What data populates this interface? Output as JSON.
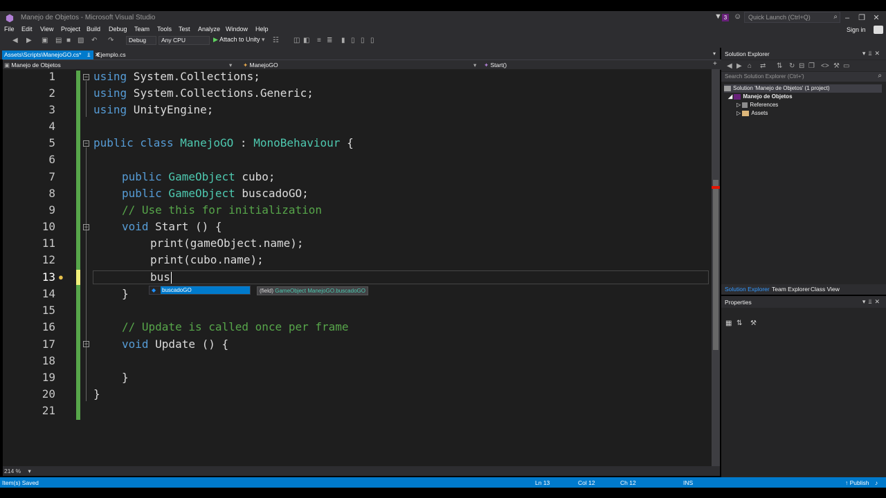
{
  "window": {
    "title": "Manejo de Objetos - Microsoft Visual Studio",
    "notification_count": "3",
    "quick_launch_placeholder": "Quick Launch (Ctrl+Q)",
    "sign_in": "Sign in"
  },
  "menu": [
    "File",
    "Edit",
    "View",
    "Project",
    "Build",
    "Debug",
    "Team",
    "Tools",
    "Test",
    "Analyze",
    "Window",
    "Help"
  ],
  "toolbar": {
    "configuration": "Debug",
    "platform": "Any CPU",
    "attach": "Attach to Unity"
  },
  "tabs": {
    "active": "Assets\\Scripts\\ManejoGO.cs*",
    "second": "Ejemplo.cs"
  },
  "navbar": {
    "project": "Manejo de Objetos",
    "class": "ManejoGO",
    "member": "Start()"
  },
  "editor": {
    "line_numbers": [
      "1",
      "2",
      "3",
      "4",
      "5",
      "6",
      "7",
      "8",
      "9",
      "10",
      "11",
      "12",
      "13",
      "14",
      "15",
      "16",
      "17",
      "18",
      "19",
      "20",
      "21"
    ],
    "lines": {
      "l1_kw": "using",
      "l1_rest": " System.Collections;",
      "l2_kw": "using",
      "l2_rest": " System.Collections.Generic;",
      "l3_kw": "using",
      "l3_rest": " UnityEngine;",
      "l5_kw": "public class",
      "l5_name": " ManejoGO",
      "l5_colon": " : ",
      "l5_base": "MonoBehaviour",
      "l5_brace": " {",
      "l7_kw": "public",
      "l7_type": " GameObject",
      "l7_rest": " cubo;",
      "l8_kw": "public",
      "l8_type": " GameObject",
      "l8_rest": " buscadoGO;",
      "l9_cmt": "// Use this for initialization",
      "l10_kw": "void",
      "l10_rest": " Start () {",
      "l11": "print(gameObject.name);",
      "l12": "print(cubo.name);",
      "l13": "bus",
      "l14": "}",
      "l16_cmt": "// Update is called once per frame",
      "l17_kw": "void",
      "l17_rest": " Update () {",
      "l19": "}",
      "l20": "}"
    },
    "completion_item": "buscadoGO",
    "tooltip": {
      "prefix": "(field) ",
      "type": "GameObject",
      "member": " ManejoGO.buscadoGO"
    },
    "zoom": "214 %"
  },
  "solution_explorer": {
    "title": "Solution Explorer",
    "search_placeholder": "Search Solution Explorer (Ctrl+')",
    "solution": "Solution 'Manejo de Objetos' (1 project)",
    "project": "Manejo de Objetos",
    "references": "References",
    "assets": "Assets",
    "tabs": [
      "Solution Explorer",
      "Team Explorer",
      "Class View"
    ]
  },
  "properties": {
    "title": "Properties"
  },
  "status": {
    "message": "Item(s) Saved",
    "line": "Ln 13",
    "col": "Col 12",
    "ch": "Ch 12",
    "mode": "INS",
    "publish": "Publish"
  },
  "colors": {
    "accent": "#007acc",
    "keyword": "#569cd6",
    "type": "#4ec9b0",
    "comment": "#57a64a"
  }
}
